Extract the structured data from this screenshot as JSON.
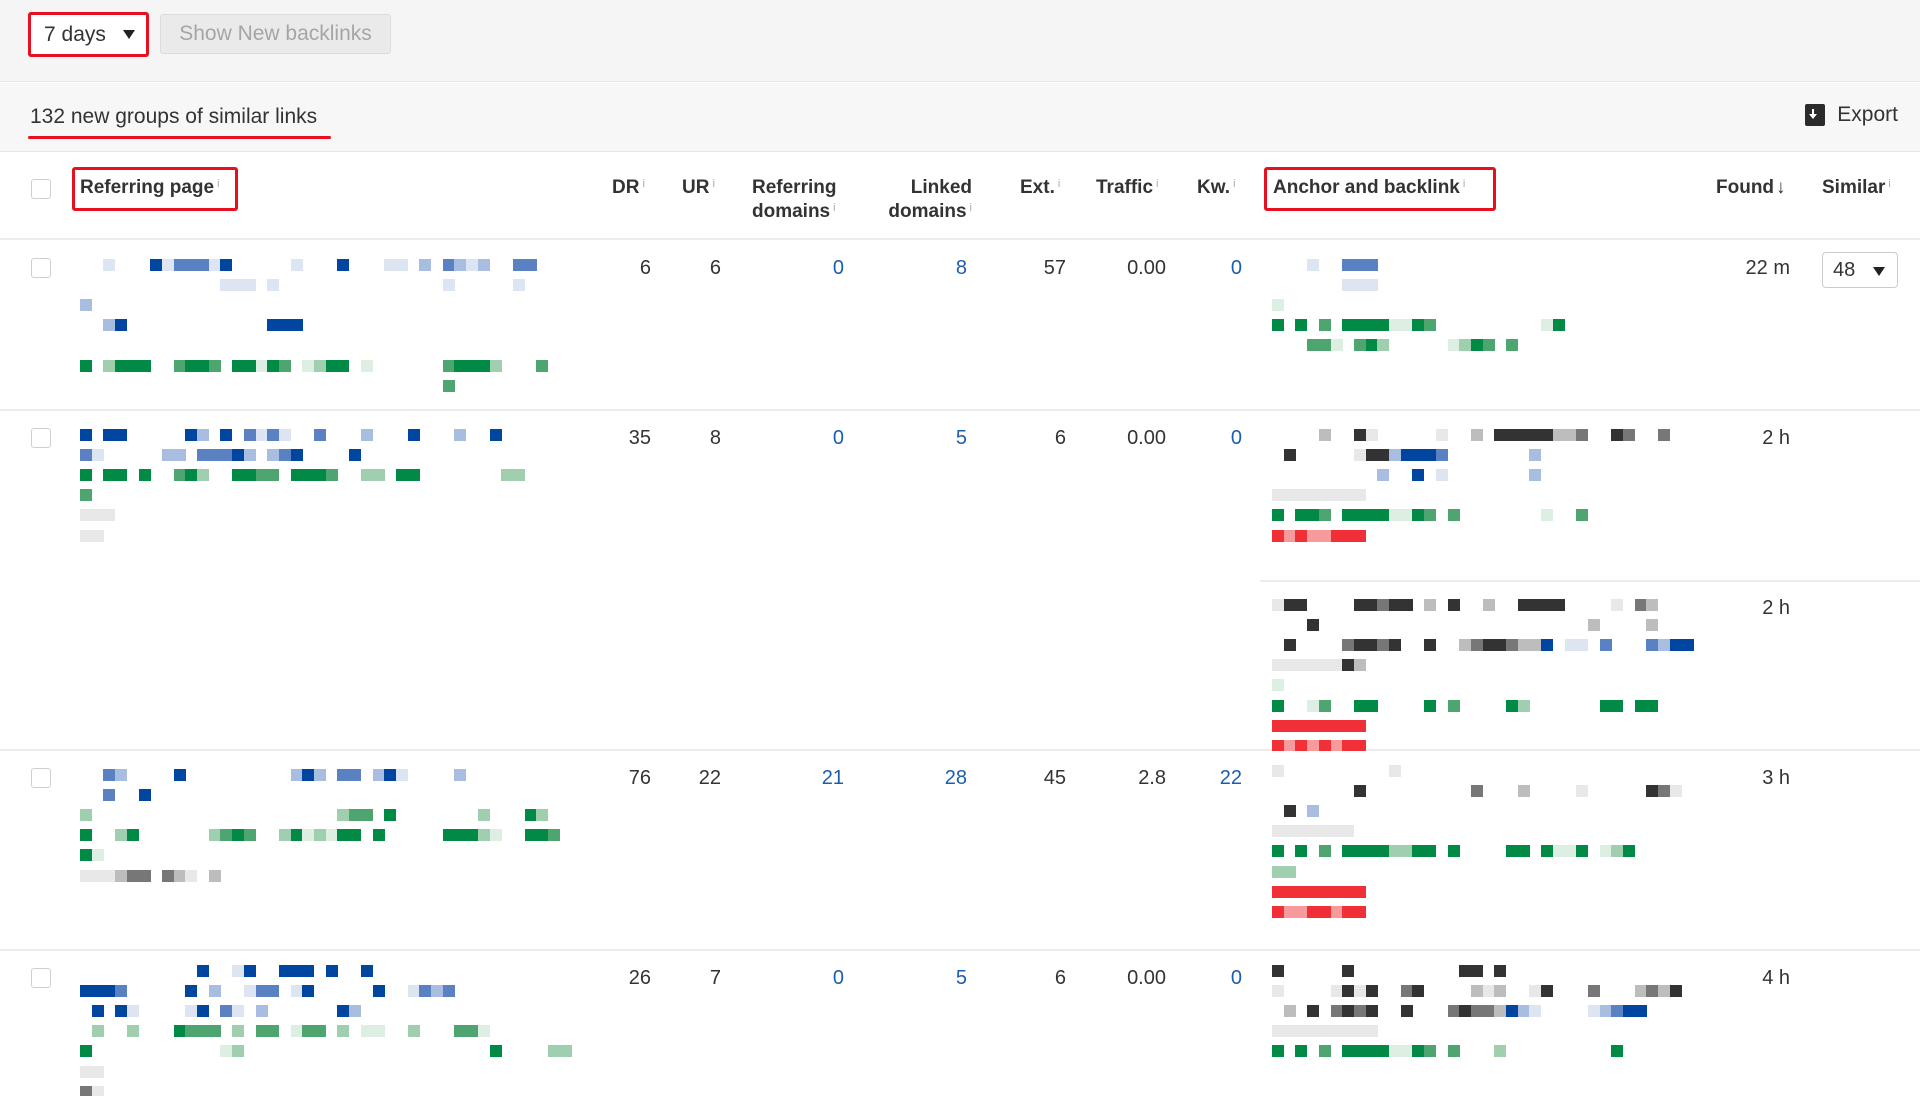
{
  "toolbar": {
    "period_value": "7 days",
    "show_button_label": "Show New backlinks"
  },
  "summary": {
    "text": "132 new groups of similar links",
    "export_label": "Export"
  },
  "table": {
    "headers": {
      "referring_page": "Referring page",
      "dr": "DR",
      "ur": "UR",
      "referring_domains_line1": "Referring",
      "referring_domains_line2": "domains",
      "linked_domains_line1": "Linked",
      "linked_domains_line2": "domains",
      "ext": "Ext.",
      "traffic": "Traffic",
      "kw": "Kw.",
      "anchor": "Anchor and backlink",
      "found": "Found",
      "found_sort": "↓",
      "similar": "Similar",
      "info_glyph": "i"
    },
    "rows": [
      {
        "dr": "6",
        "ur": "6",
        "referring_domains": "0",
        "linked_domains": "8",
        "ext": "57",
        "traffic": "0.00",
        "kw": "0",
        "found": [
          "22 m"
        ],
        "similar": "48",
        "content_redacted": true
      },
      {
        "dr": "35",
        "ur": "8",
        "referring_domains": "0",
        "linked_domains": "5",
        "ext": "6",
        "traffic": "0.00",
        "kw": "0",
        "found": [
          "2 h",
          "2 h"
        ],
        "similar": null,
        "content_redacted": true
      },
      {
        "dr": "76",
        "ur": "22",
        "referring_domains": "21",
        "linked_domains": "28",
        "ext": "45",
        "traffic": "2.8",
        "kw": "22",
        "found": [
          "3 h"
        ],
        "similar": null,
        "content_redacted": true
      },
      {
        "dr": "26",
        "ur": "7",
        "referring_domains": "0",
        "linked_domains": "5",
        "ext": "6",
        "traffic": "0.00",
        "kw": "0",
        "found": [
          "4 h"
        ],
        "similar": null,
        "content_redacted": true
      }
    ]
  },
  "colors": {
    "highlight_red": "#e8101e",
    "link_blue": "#1b5dae",
    "redacted_blue": "#0046a0",
    "redacted_green": "#008a45",
    "redacted_dark": "#333333",
    "redacted_red": "#f03036"
  }
}
